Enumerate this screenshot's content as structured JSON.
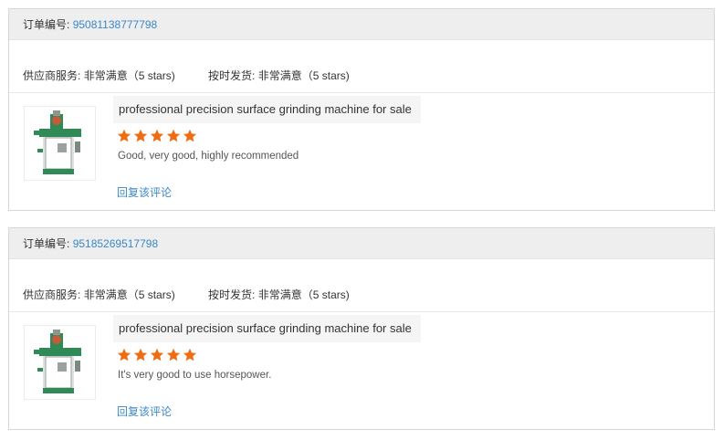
{
  "labels": {
    "order_number_label": "订单编号:",
    "supplier_service_label": "供应商服务:",
    "on_time_shipping_label": "按时发货:",
    "reply_link": "回复该评论"
  },
  "colors": {
    "link": "#3a87c8",
    "star": "#f06c12",
    "header_bg": "#eeeeee"
  },
  "reviews": [
    {
      "order_number": "95081138777798",
      "supplier_service_rating": "非常满意（5 stars)",
      "on_time_shipping_rating": "非常满意（5 stars)",
      "product_title": "professional precision surface grinding machine for sale",
      "stars": 5,
      "review_text": "Good, very good, highly recommended",
      "thumbnail": "grinding-machine-thumbnail"
    },
    {
      "order_number": "95185269517798",
      "supplier_service_rating": "非常满意（5 stars)",
      "on_time_shipping_rating": "非常满意（5 stars)",
      "product_title": "professional precision surface grinding machine for sale",
      "stars": 5,
      "review_text": "It's very good to use horsepower.",
      "thumbnail": "grinding-machine-thumbnail"
    }
  ]
}
